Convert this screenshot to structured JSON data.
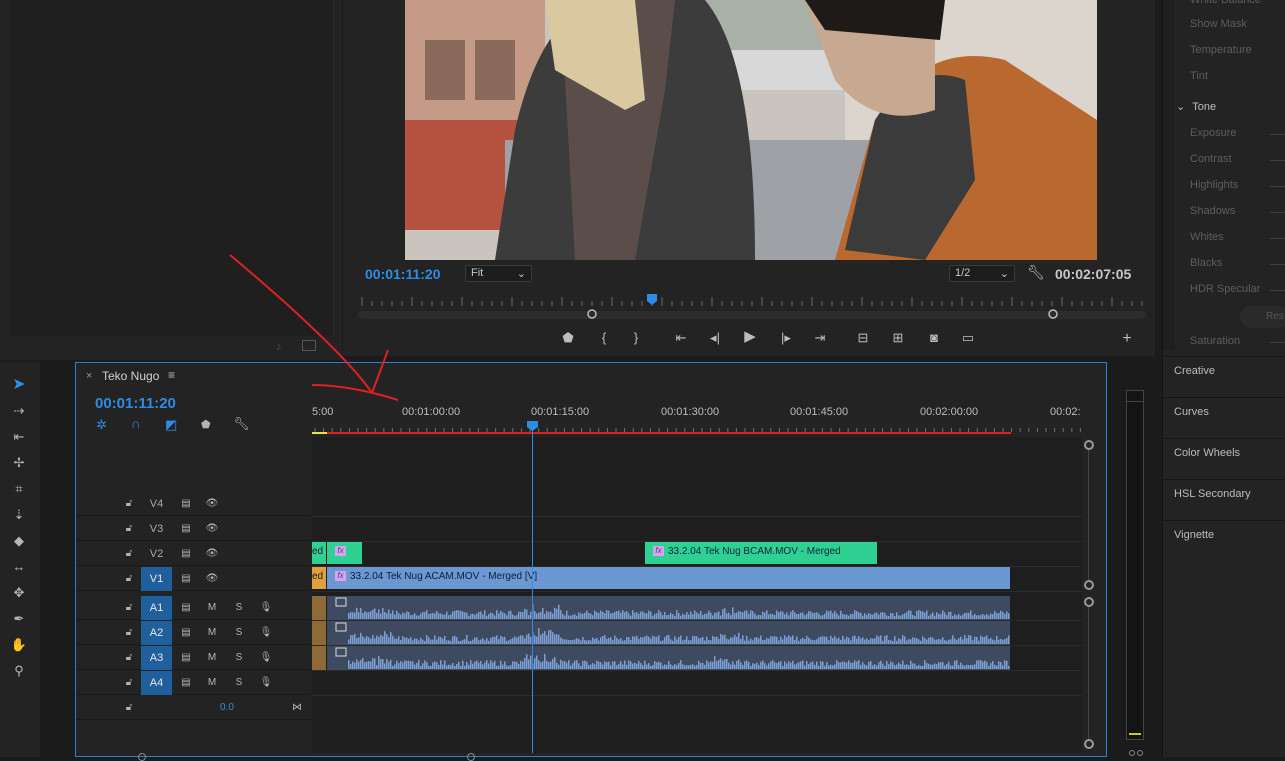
{
  "program": {
    "current_tc": "00:01:11:20",
    "zoom": "Fit",
    "resolution": "1/2",
    "duration_tc": "00:02:07:05"
  },
  "lumetri": {
    "items": [
      "White Balance",
      "Show Mask",
      "Temperature",
      "Tint"
    ],
    "tone_label": "Tone",
    "tone_items": [
      "Exposure",
      "Contrast",
      "Highlights",
      "Shadows",
      "Whites",
      "Blacks",
      "HDR Specular"
    ],
    "reset_label": "Res",
    "saturation": "Saturation",
    "sections": [
      "Creative",
      "Curves",
      "Color Wheels",
      "HSL Secondary",
      "Vignette"
    ]
  },
  "timeline": {
    "tab_close": "×",
    "sequence_name": "Teko Nugo",
    "menu_icon": "≡",
    "current_tc": "00:01:11:20",
    "ruler": [
      "5:00",
      "00:01:00:00",
      "00:01:15:00",
      "00:01:30:00",
      "00:01:45:00",
      "00:02:00:00",
      "00:02:"
    ],
    "video_tracks": [
      "V4",
      "V3",
      "V2",
      "V1"
    ],
    "audio_tracks": [
      "A1",
      "A2",
      "A3",
      "A4"
    ],
    "mute": "M",
    "solo": "S",
    "master_volume": "0.0",
    "clips": {
      "v2_left_stub": "ed",
      "v1_left_stub": "ed",
      "v2_bcam": "33.2.04 Tek Nug BCAM.MOV - Merged",
      "v1_acam": "33.2.04 Tek Nug ACAM.MOV - Merged [V]"
    },
    "fx_glyph": "fx"
  },
  "colors": {
    "accent_blue": "#2e8ce6",
    "clip_green": "#2fd193",
    "clip_blue": "#6b98d2",
    "annotation_red": "#e02020"
  }
}
